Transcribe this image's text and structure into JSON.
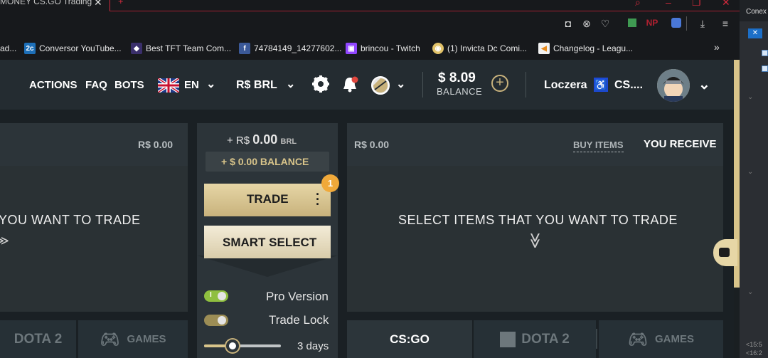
{
  "browser": {
    "tab_title": "MONEY CS.GO Trading",
    "bookmarks": [
      {
        "label": "ad...",
        "icon": "folder-icon"
      },
      {
        "label": "Conversor YouTube...",
        "icon": "2c-icon"
      },
      {
        "label": "Best TFT Team Com...",
        "icon": "tft-icon"
      },
      {
        "label": "74784149_14277602...",
        "icon": "facebook-icon"
      },
      {
        "label": "brincou - Twitch",
        "icon": "twitch-icon"
      },
      {
        "label": "(1) Invicta Dc Comi...",
        "icon": "discord-icon"
      },
      {
        "label": "Changelog - Leagu...",
        "icon": "league-icon"
      }
    ],
    "right_window_title": "Conex",
    "right_window_times": [
      "<15:5",
      "<16:2"
    ]
  },
  "nav": {
    "actions": "ACTIONS",
    "faq": "FAQ",
    "bots": "BOTS",
    "language": "EN",
    "currency": "R$ BRL",
    "balance_value": "$ 8.09",
    "balance_label": "BALANCE",
    "username": "Loczera",
    "username_suffix": "CS...."
  },
  "left_panel": {
    "price": "R$ 0.00",
    "prompt": "YOU WANT TO TRADE",
    "tabs": [
      "DOTA 2",
      "GAMES"
    ]
  },
  "center": {
    "trade_value_prefix": "+ R$",
    "trade_value": "0.00",
    "trade_currency": "BRL",
    "balance_line": "+ $ 0.00 BALANCE",
    "trade_button": "TRADE",
    "trade_badge": "1",
    "smart_select_button": "SMART SELECT",
    "pro_version_label": "Pro Version",
    "pro_version_toggle_letter": "I",
    "trade_lock_label": "Trade Lock",
    "trade_lock_days": "3 days",
    "trade_lock_days_value": 3,
    "trade_lock_slider_fraction": 0.37
  },
  "right_panel": {
    "price": "R$ 0.00",
    "buy_items": "BUY ITEMS",
    "you_receive": "YOU RECEIVE",
    "prompt": "SELECT ITEMS THAT YOU WANT TO TRADE",
    "tabs": [
      "CS:GO",
      "DOTA 2",
      "GAMES"
    ]
  },
  "colors": {
    "accent_gold": "#d8c48a",
    "toggle_green": "#8fbf3f",
    "badge_orange": "#f0a93a",
    "notification_red": "#e0473e"
  }
}
